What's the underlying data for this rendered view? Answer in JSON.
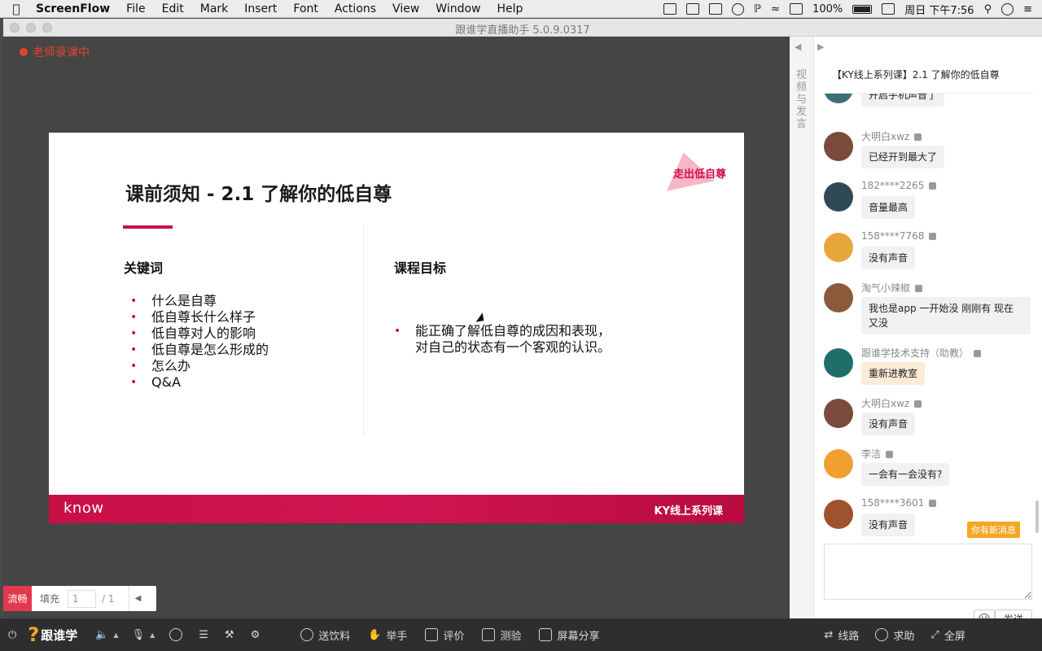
{
  "menubar": {
    "app_name": "ScreenFlow",
    "menus": [
      "File",
      "Edit",
      "Mark",
      "Insert",
      "Font",
      "Actions",
      "View",
      "Window",
      "Help"
    ],
    "battery": "100%",
    "clock": "周日 下午7:56"
  },
  "window": {
    "title": "跟谁学直播助手 5.0.9.0317",
    "recording_status": "老师录课中"
  },
  "slide": {
    "title": "课前须知 - 2.1 了解你的低自尊",
    "tag": "走出低自尊",
    "keywords_label": "关键词",
    "keywords": [
      "什么是自尊",
      "低自尊长什么样子",
      "低自尊对人的影响",
      "低自尊是怎么形成的",
      "怎么办",
      "Q&A"
    ],
    "goal_label": "课程目标",
    "goal": "能正确了解低自尊的成因和表现，\n对自己的状态有一个客观的认识。",
    "footer_brand": "know",
    "footer_series": "KY线上系列课"
  },
  "playback": {
    "quality": "流畅",
    "fit": "填充",
    "page_current": "1",
    "page_total": "/ 1"
  },
  "panel": {
    "rail_label": "视频与发言",
    "title": "【KY线上系列课】2.1 了解你的低自尊",
    "messages": [
      {
        "name": "",
        "text": "开启手机声音了",
        "avatar_color": "#3a6f7a"
      },
      {
        "name": "大明白xwz",
        "text": "已经开到最大了",
        "avatar_color": "#7a4a3a"
      },
      {
        "name": "182****2265",
        "text": "音量最高",
        "avatar_color": "#2f4a55"
      },
      {
        "name": "158****7768",
        "text": "没有声音",
        "avatar_color": "#e8a73c"
      },
      {
        "name": "淘气小辣椒",
        "text": "我也是app 一开始没 刚刚有 现在\n又没",
        "avatar_color": "#8a5a3a"
      },
      {
        "name": "跟谁学技术支持（助教）",
        "text": "重新进教室",
        "avatar_color": "#1f6e6a"
      },
      {
        "name": "大明白xwz",
        "text": "没有声音",
        "avatar_color": "#7a4a3a"
      },
      {
        "name": "李洁",
        "text": "一会有一会没有?",
        "avatar_color": "#f0a030"
      },
      {
        "name": "158****3601",
        "text": "没有声音",
        "avatar_color": "#a0522d"
      }
    ],
    "new_message_badge": "你有新消息",
    "send_label": "发送"
  },
  "toolbar": {
    "logo_text": "跟谁学",
    "drinks": "送饮料",
    "raise_hand": "举手",
    "rate": "评价",
    "quiz": "测验",
    "screen_share": "屏幕分享",
    "route": "线路",
    "help": "求助",
    "fullscreen": "全屏"
  }
}
